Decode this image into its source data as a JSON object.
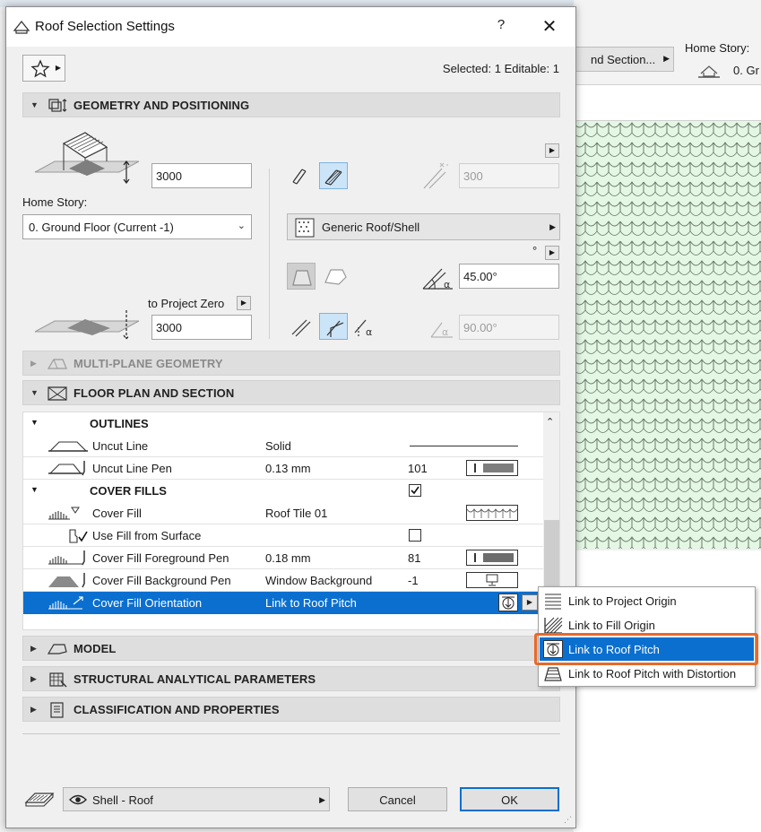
{
  "background": {
    "section_button": "nd Section...",
    "home_story_label": "Home Story:",
    "home_story_value": "0. Gr"
  },
  "dialog": {
    "title": "Roof Selection Settings",
    "help": "?",
    "close": "✕",
    "selected_info": "Selected: 1 Editable: 1"
  },
  "sections": {
    "geometry": "GEOMETRY AND POSITIONING",
    "multiplane": "MULTI-PLANE GEOMETRY",
    "floorplan": "FLOOR PLAN AND SECTION",
    "model": "MODEL",
    "structural": "STRUCTURAL ANALYTICAL PARAMETERS",
    "classification": "CLASSIFICATION AND PROPERTIES"
  },
  "geometry": {
    "height_value": "3000",
    "home_story_label": "Home Story:",
    "home_story_value": "0. Ground Floor (Current -1)",
    "to_project_zero_label": "to Project Zero",
    "project_zero_value": "3000",
    "thickness_value": "300",
    "building_material": "Generic Roof/Shell",
    "degree_symbol": "°",
    "pitch_value": "45.00°",
    "edge_angle_value": "90.00°"
  },
  "table": {
    "groups": {
      "outlines": "OUTLINES",
      "cover_fills": "COVER FILLS"
    },
    "rows": [
      {
        "name": "Uncut Line",
        "value": "Solid",
        "num": ""
      },
      {
        "name": "Uncut Line Pen",
        "value": "0.13 mm",
        "num": "101"
      },
      {
        "name": "Cover Fill",
        "value": "Roof Tile 01",
        "num": ""
      },
      {
        "name": "Use Fill from Surface",
        "value": "",
        "num": ""
      },
      {
        "name": "Cover Fill Foreground Pen",
        "value": "0.18 mm",
        "num": "81"
      },
      {
        "name": "Cover Fill Background Pen",
        "value": "Window Background",
        "num": "-1"
      },
      {
        "name": "Cover Fill Orientation",
        "value": "Link to Roof Pitch",
        "num": ""
      }
    ]
  },
  "popup": {
    "items": [
      {
        "label": "Link to Project Origin"
      },
      {
        "label": "Link to Fill Origin"
      },
      {
        "label": "Link to Roof Pitch"
      },
      {
        "label": "Link to Roof Pitch with Distortion"
      }
    ]
  },
  "footer": {
    "layer": "Shell - Roof",
    "cancel": "Cancel",
    "ok": "OK"
  },
  "colors": {
    "accent": "#0a6fcf",
    "highlight_ring": "#e8692a",
    "canvas_fill": "#e4f7e4"
  }
}
